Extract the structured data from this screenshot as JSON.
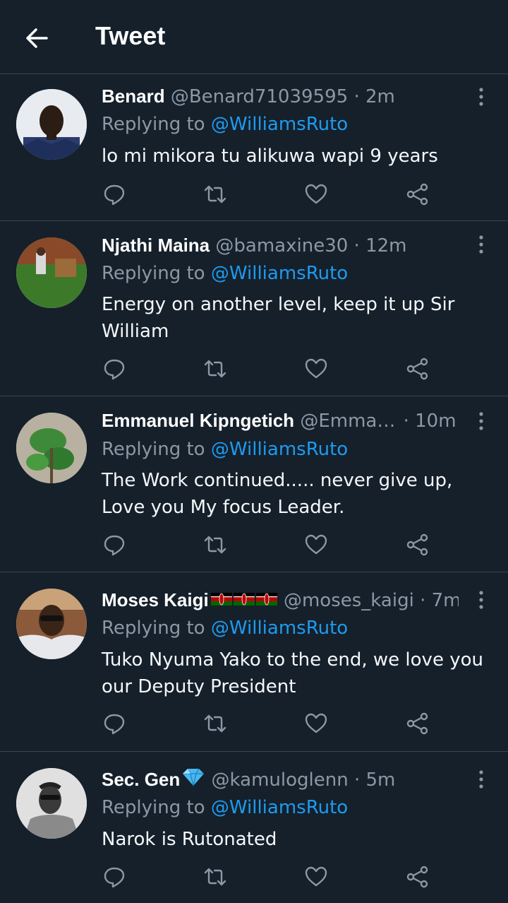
{
  "header": {
    "title": "Tweet"
  },
  "replies": [
    {
      "name": "Benard",
      "handle": "@Benard71039595",
      "time": "2m",
      "replying_label": "Replying to",
      "mention": "@WilliamsRuto",
      "text": "lo mi mikora tu alikuwa wapi 9 years"
    },
    {
      "name": "Njathi Maina",
      "handle": "@bamaxine30",
      "time": "12m",
      "replying_label": "Replying to",
      "mention": "@WilliamsRuto",
      "text": "Energy on another level, keep it up Sir William"
    },
    {
      "name": "Emmanuel Kipngetich",
      "handle": "@Emman...",
      "time": "10m",
      "replying_label": "Replying to",
      "mention": "@WilliamsRuto",
      "text": "The Work continued..... never give up, Love you My focus Leader."
    },
    {
      "name": "Moses Kaigi",
      "handle": "@moses_kaigi",
      "time": "7m",
      "replying_label": "Replying to",
      "mention": "@WilliamsRuto",
      "text": "Tuko Nyuma Yako to the end, we love you our Deputy President"
    },
    {
      "name": "Sec. Gen",
      "handle": "@kamuloglenn",
      "time": "5m",
      "replying_label": "Replying to",
      "mention": "@WilliamsRuto",
      "text": "Narok is Rutonated"
    }
  ],
  "separator": "·",
  "icons": {
    "back": "arrow-left-icon",
    "more": "more-vertical-icon",
    "reply": "reply-icon",
    "retweet": "retweet-icon",
    "like": "heart-icon",
    "share": "share-icon",
    "flag": "kenya-flag-icon",
    "gem": "gem-icon"
  },
  "colors": {
    "background": "#15202b",
    "secondary_text": "#8b98a5",
    "link": "#1d9bf0",
    "divider": "#38444d"
  }
}
